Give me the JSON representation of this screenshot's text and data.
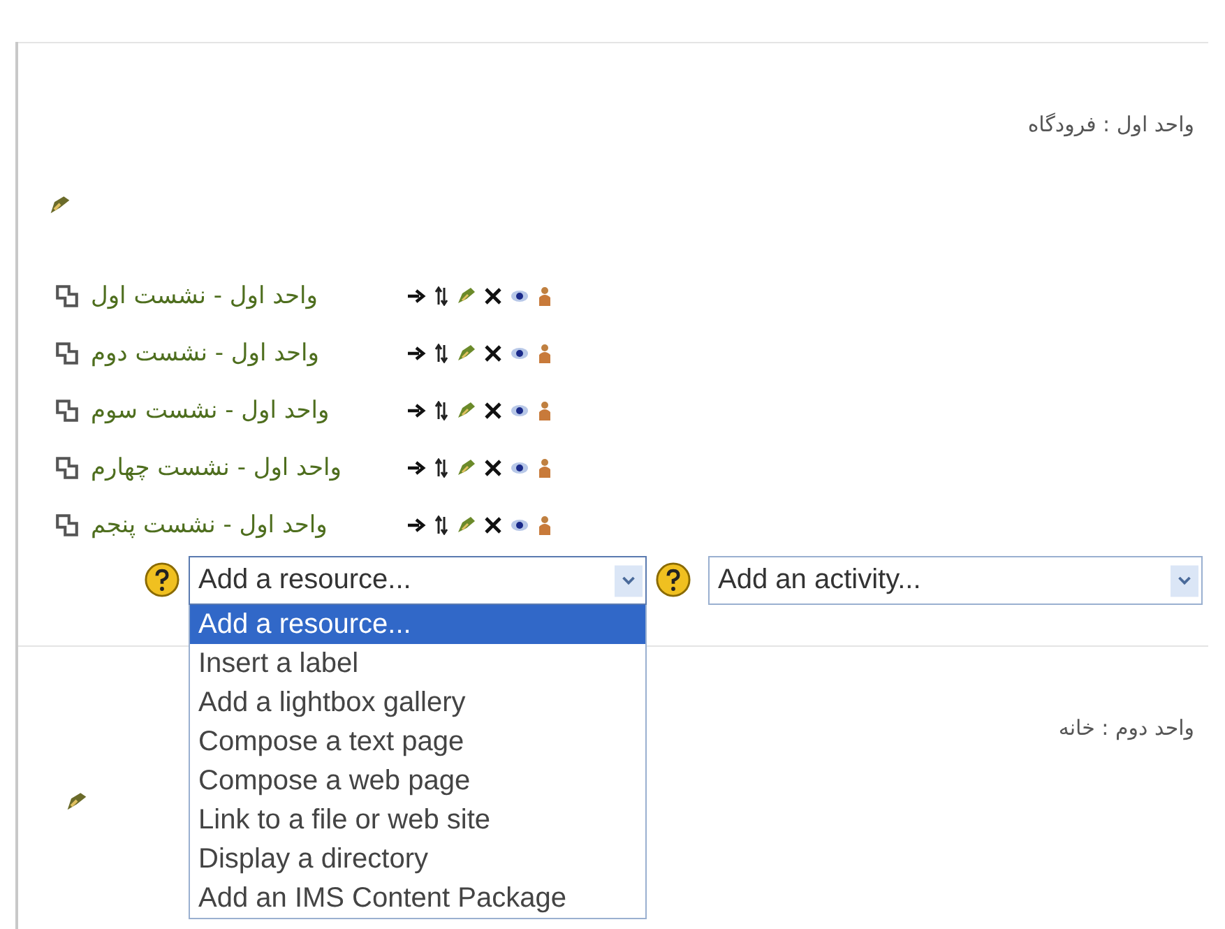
{
  "sections": [
    {
      "title": "واحد اول : فرودگاه",
      "resources": [
        {
          "title": "واحد اول - نشست اول"
        },
        {
          "title": "واحد اول - نشست دوم"
        },
        {
          "title": "واحد اول - نشست سوم"
        },
        {
          "title": "واحد اول - نشست چهارم"
        },
        {
          "title": "واحد اول - نشست پنجم"
        }
      ],
      "resource_select": {
        "value": "Add a resource...",
        "expanded": true,
        "options": [
          {
            "label": "Add a resource...",
            "selected": true
          },
          {
            "label": "Insert a label",
            "selected": false
          },
          {
            "label": "Add a lightbox gallery",
            "selected": false
          },
          {
            "label": "Compose a text page",
            "selected": false
          },
          {
            "label": "Compose a web page",
            "selected": false
          },
          {
            "label": "Link to a file or web site",
            "selected": false
          },
          {
            "label": "Display a directory",
            "selected": false
          },
          {
            "label": "Add an IMS Content Package",
            "selected": false
          }
        ]
      },
      "activity_select": {
        "value": "Add an activity..."
      }
    },
    {
      "title": "واحد دوم : خانه"
    }
  ]
}
